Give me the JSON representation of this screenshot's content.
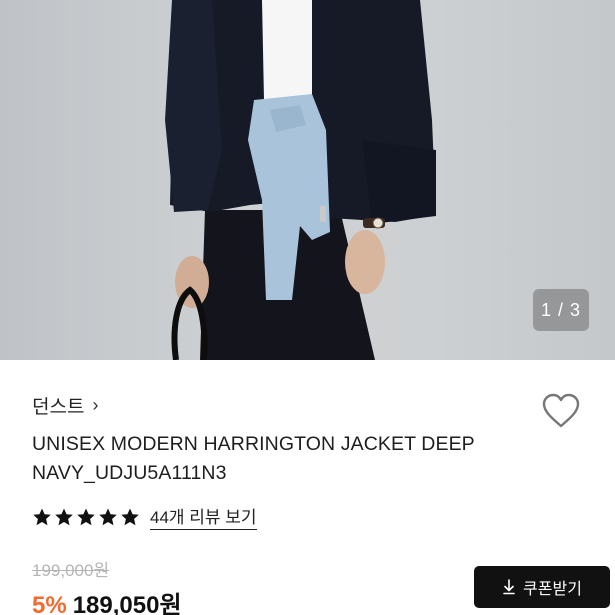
{
  "gallery": {
    "indicator": "1 / 3",
    "image_alt": "model wearing navy jacket"
  },
  "product": {
    "brand": "던스트",
    "brand_chevron": "›",
    "name": "UNISEX MODERN HARRINGTON JACKET DEEP NAVY_UDJU5A111N3",
    "rating_stars": 5,
    "review_link": "44개 리뷰 보기",
    "original_price": "199,000원",
    "discount": "5%",
    "sale_price": "189,050원"
  },
  "actions": {
    "coupon_label": "쿠폰받기"
  },
  "icons": {
    "wishlist": "heart-icon",
    "download": "download-icon",
    "star": "star-icon",
    "brand_chevron": "chevron-right-icon"
  },
  "colors": {
    "discount": "#f36a2e",
    "button_bg": "#111111",
    "star": "#111111"
  }
}
